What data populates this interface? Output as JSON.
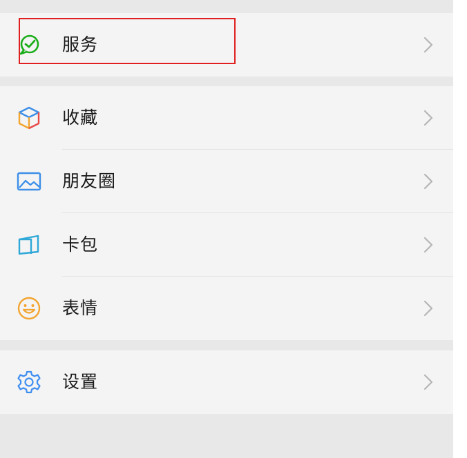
{
  "menu": {
    "service": {
      "label": "服务",
      "icon": "wechat-pay-icon"
    },
    "favorites": {
      "label": "收藏",
      "icon": "cube-icon"
    },
    "moments": {
      "label": "朋友圈",
      "icon": "picture-icon"
    },
    "cards": {
      "label": "卡包",
      "icon": "card-wallet-icon"
    },
    "stickers": {
      "label": "表情",
      "icon": "smiley-icon"
    },
    "settings": {
      "label": "设置",
      "icon": "gear-icon"
    }
  },
  "colors": {
    "highlight": "#e02020",
    "service_green": "#1aad19",
    "moments_blue": "#3d8fe8",
    "cards_teal": "#2fa8d8",
    "stickers_orange": "#f2a531",
    "settings_blue": "#3e8ef0"
  }
}
